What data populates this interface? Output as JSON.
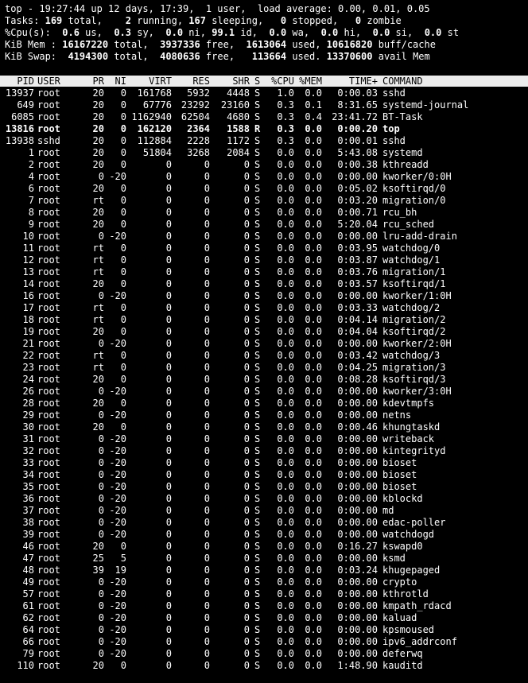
{
  "summary": {
    "uptime_line": "top - 19:27:44 up 12 days, 17:39,  1 user,  load average: 0.00, 0.01, 0.05",
    "tasks": {
      "label": "Tasks:",
      "total": "169",
      "running": "2",
      "sleeping": "167",
      "stopped": "0",
      "zombie": "0"
    },
    "cpu": {
      "label": "%Cpu(s):",
      "us": "0.6",
      "sy": "0.3",
      "ni": "0.0",
      "id": "99.1",
      "wa": "0.0",
      "hi": "0.0",
      "si": "0.0",
      "st": "0.0"
    },
    "mem": {
      "label": "KiB Mem :",
      "total": "16167220",
      "free": "3937336",
      "used": "1613064",
      "buff_cache": "10616820"
    },
    "swap": {
      "label": "KiB Swap:",
      "total": "4194300",
      "free": "4080636",
      "used": "113664",
      "avail_mem": "13370600"
    },
    "words": {
      "total": "total,",
      "running": "running,",
      "sleeping": "sleeping,",
      "stopped": "stopped,",
      "zombie": "zombie",
      "us": "us,",
      "sy": "sy,",
      "ni": "ni,",
      "id": "id,",
      "wa": "wa,",
      "hi": "hi,",
      "si": "si,",
      "st": "st",
      "free": "free,",
      "used": "used,",
      "used_dot": "used.",
      "buff_cache": "buff/cache",
      "avail_mem": "avail Mem"
    }
  },
  "columns": [
    "PID",
    "USER",
    "PR",
    "NI",
    "VIRT",
    "RES",
    "SHR",
    "S",
    "%CPU",
    "%MEM",
    "TIME+",
    "COMMAND"
  ],
  "processes": [
    [
      "13937",
      "root",
      "20",
      "0",
      "161768",
      "5932",
      "4448",
      "S",
      "1.0",
      "0.0",
      "0:00.03",
      "sshd"
    ],
    [
      "649",
      "root",
      "20",
      "0",
      "67776",
      "23292",
      "23160",
      "S",
      "0.3",
      "0.1",
      "8:31.65",
      "systemd-journal"
    ],
    [
      "6085",
      "root",
      "20",
      "0",
      "1162940",
      "62504",
      "4680",
      "S",
      "0.3",
      "0.4",
      "23:41.72",
      "BT-Task"
    ],
    [
      "13816",
      "root",
      "20",
      "0",
      "162120",
      "2364",
      "1588",
      "R",
      "0.3",
      "0.0",
      "0:00.20",
      "top"
    ],
    [
      "13938",
      "sshd",
      "20",
      "0",
      "112884",
      "2228",
      "1172",
      "S",
      "0.3",
      "0.0",
      "0:00.01",
      "sshd"
    ],
    [
      "1",
      "root",
      "20",
      "0",
      "51804",
      "3268",
      "2084",
      "S",
      "0.0",
      "0.0",
      "5:43.08",
      "systemd"
    ],
    [
      "2",
      "root",
      "20",
      "0",
      "0",
      "0",
      "0",
      "S",
      "0.0",
      "0.0",
      "0:00.38",
      "kthreadd"
    ],
    [
      "4",
      "root",
      "0",
      "-20",
      "0",
      "0",
      "0",
      "S",
      "0.0",
      "0.0",
      "0:00.00",
      "kworker/0:0H"
    ],
    [
      "6",
      "root",
      "20",
      "0",
      "0",
      "0",
      "0",
      "S",
      "0.0",
      "0.0",
      "0:05.02",
      "ksoftirqd/0"
    ],
    [
      "7",
      "root",
      "rt",
      "0",
      "0",
      "0",
      "0",
      "S",
      "0.0",
      "0.0",
      "0:03.20",
      "migration/0"
    ],
    [
      "8",
      "root",
      "20",
      "0",
      "0",
      "0",
      "0",
      "S",
      "0.0",
      "0.0",
      "0:00.71",
      "rcu_bh"
    ],
    [
      "9",
      "root",
      "20",
      "0",
      "0",
      "0",
      "0",
      "S",
      "0.0",
      "0.0",
      "5:20.04",
      "rcu_sched"
    ],
    [
      "10",
      "root",
      "0",
      "-20",
      "0",
      "0",
      "0",
      "S",
      "0.0",
      "0.0",
      "0:00.00",
      "lru-add-drain"
    ],
    [
      "11",
      "root",
      "rt",
      "0",
      "0",
      "0",
      "0",
      "S",
      "0.0",
      "0.0",
      "0:03.95",
      "watchdog/0"
    ],
    [
      "12",
      "root",
      "rt",
      "0",
      "0",
      "0",
      "0",
      "S",
      "0.0",
      "0.0",
      "0:03.87",
      "watchdog/1"
    ],
    [
      "13",
      "root",
      "rt",
      "0",
      "0",
      "0",
      "0",
      "S",
      "0.0",
      "0.0",
      "0:03.76",
      "migration/1"
    ],
    [
      "14",
      "root",
      "20",
      "0",
      "0",
      "0",
      "0",
      "S",
      "0.0",
      "0.0",
      "0:03.57",
      "ksoftirqd/1"
    ],
    [
      "16",
      "root",
      "0",
      "-20",
      "0",
      "0",
      "0",
      "S",
      "0.0",
      "0.0",
      "0:00.00",
      "kworker/1:0H"
    ],
    [
      "17",
      "root",
      "rt",
      "0",
      "0",
      "0",
      "0",
      "S",
      "0.0",
      "0.0",
      "0:03.33",
      "watchdog/2"
    ],
    [
      "18",
      "root",
      "rt",
      "0",
      "0",
      "0",
      "0",
      "S",
      "0.0",
      "0.0",
      "0:04.14",
      "migration/2"
    ],
    [
      "19",
      "root",
      "20",
      "0",
      "0",
      "0",
      "0",
      "S",
      "0.0",
      "0.0",
      "0:04.04",
      "ksoftirqd/2"
    ],
    [
      "21",
      "root",
      "0",
      "-20",
      "0",
      "0",
      "0",
      "S",
      "0.0",
      "0.0",
      "0:00.00",
      "kworker/2:0H"
    ],
    [
      "22",
      "root",
      "rt",
      "0",
      "0",
      "0",
      "0",
      "S",
      "0.0",
      "0.0",
      "0:03.42",
      "watchdog/3"
    ],
    [
      "23",
      "root",
      "rt",
      "0",
      "0",
      "0",
      "0",
      "S",
      "0.0",
      "0.0",
      "0:04.25",
      "migration/3"
    ],
    [
      "24",
      "root",
      "20",
      "0",
      "0",
      "0",
      "0",
      "S",
      "0.0",
      "0.0",
      "0:08.28",
      "ksoftirqd/3"
    ],
    [
      "26",
      "root",
      "0",
      "-20",
      "0",
      "0",
      "0",
      "S",
      "0.0",
      "0.0",
      "0:00.00",
      "kworker/3:0H"
    ],
    [
      "28",
      "root",
      "20",
      "0",
      "0",
      "0",
      "0",
      "S",
      "0.0",
      "0.0",
      "0:00.00",
      "kdevtmpfs"
    ],
    [
      "29",
      "root",
      "0",
      "-20",
      "0",
      "0",
      "0",
      "S",
      "0.0",
      "0.0",
      "0:00.00",
      "netns"
    ],
    [
      "30",
      "root",
      "20",
      "0",
      "0",
      "0",
      "0",
      "S",
      "0.0",
      "0.0",
      "0:00.46",
      "khungtaskd"
    ],
    [
      "31",
      "root",
      "0",
      "-20",
      "0",
      "0",
      "0",
      "S",
      "0.0",
      "0.0",
      "0:00.00",
      "writeback"
    ],
    [
      "32",
      "root",
      "0",
      "-20",
      "0",
      "0",
      "0",
      "S",
      "0.0",
      "0.0",
      "0:00.00",
      "kintegrityd"
    ],
    [
      "33",
      "root",
      "0",
      "-20",
      "0",
      "0",
      "0",
      "S",
      "0.0",
      "0.0",
      "0:00.00",
      "bioset"
    ],
    [
      "34",
      "root",
      "0",
      "-20",
      "0",
      "0",
      "0",
      "S",
      "0.0",
      "0.0",
      "0:00.00",
      "bioset"
    ],
    [
      "35",
      "root",
      "0",
      "-20",
      "0",
      "0",
      "0",
      "S",
      "0.0",
      "0.0",
      "0:00.00",
      "bioset"
    ],
    [
      "36",
      "root",
      "0",
      "-20",
      "0",
      "0",
      "0",
      "S",
      "0.0",
      "0.0",
      "0:00.00",
      "kblockd"
    ],
    [
      "37",
      "root",
      "0",
      "-20",
      "0",
      "0",
      "0",
      "S",
      "0.0",
      "0.0",
      "0:00.00",
      "md"
    ],
    [
      "38",
      "root",
      "0",
      "-20",
      "0",
      "0",
      "0",
      "S",
      "0.0",
      "0.0",
      "0:00.00",
      "edac-poller"
    ],
    [
      "39",
      "root",
      "0",
      "-20",
      "0",
      "0",
      "0",
      "S",
      "0.0",
      "0.0",
      "0:00.00",
      "watchdogd"
    ],
    [
      "46",
      "root",
      "20",
      "0",
      "0",
      "0",
      "0",
      "S",
      "0.0",
      "0.0",
      "0:16.27",
      "kswapd0"
    ],
    [
      "47",
      "root",
      "25",
      "5",
      "0",
      "0",
      "0",
      "S",
      "0.0",
      "0.0",
      "0:00.00",
      "ksmd"
    ],
    [
      "48",
      "root",
      "39",
      "19",
      "0",
      "0",
      "0",
      "S",
      "0.0",
      "0.0",
      "0:03.24",
      "khugepaged"
    ],
    [
      "49",
      "root",
      "0",
      "-20",
      "0",
      "0",
      "0",
      "S",
      "0.0",
      "0.0",
      "0:00.00",
      "crypto"
    ],
    [
      "57",
      "root",
      "0",
      "-20",
      "0",
      "0",
      "0",
      "S",
      "0.0",
      "0.0",
      "0:00.00",
      "kthrotld"
    ],
    [
      "61",
      "root",
      "0",
      "-20",
      "0",
      "0",
      "0",
      "S",
      "0.0",
      "0.0",
      "0:00.00",
      "kmpath_rdacd"
    ],
    [
      "62",
      "root",
      "0",
      "-20",
      "0",
      "0",
      "0",
      "S",
      "0.0",
      "0.0",
      "0:00.00",
      "kaluad"
    ],
    [
      "64",
      "root",
      "0",
      "-20",
      "0",
      "0",
      "0",
      "S",
      "0.0",
      "0.0",
      "0:00.00",
      "kpsmoused"
    ],
    [
      "66",
      "root",
      "0",
      "-20",
      "0",
      "0",
      "0",
      "S",
      "0.0",
      "0.0",
      "0:00.00",
      "ipv6_addrconf"
    ],
    [
      "79",
      "root",
      "0",
      "-20",
      "0",
      "0",
      "0",
      "S",
      "0.0",
      "0.0",
      "0:00.00",
      "deferwq"
    ],
    [
      "110",
      "root",
      "20",
      "0",
      "0",
      "0",
      "0",
      "S",
      "0.0",
      "0.0",
      "1:48.90",
      "kauditd"
    ]
  ],
  "highlighted_pid": "13816",
  "colors": {
    "background": "#000000",
    "foreground": "#ffffff",
    "header_bg": "#ececec",
    "header_fg": "#000000"
  }
}
